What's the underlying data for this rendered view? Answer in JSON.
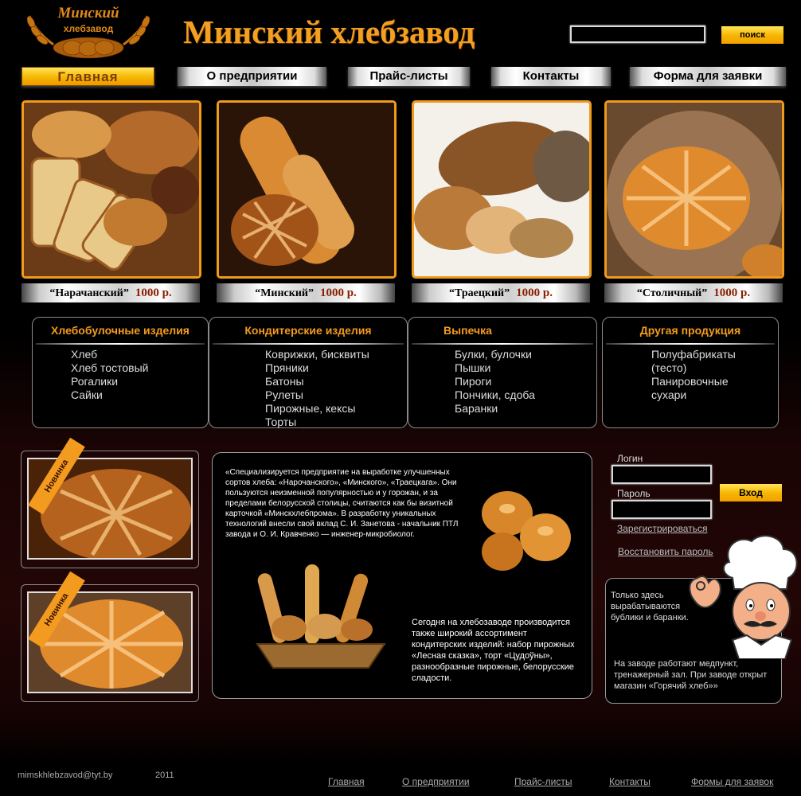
{
  "header": {
    "logo_line1": "Минский",
    "logo_line2": "хлебзавод",
    "title": "Минский хлебзавод",
    "search_placeholder": "",
    "search_button": "поиск"
  },
  "nav": {
    "items": [
      {
        "label": "Главная",
        "active": true
      },
      {
        "label": "О предприятии"
      },
      {
        "label": "Прайс-листы"
      },
      {
        "label": "Контакты"
      },
      {
        "label": "Форма для заявки"
      }
    ]
  },
  "products": [
    {
      "name": "“Нарачанский”",
      "price": "1000 р."
    },
    {
      "name": "“Минский”",
      "price": "1000 р."
    },
    {
      "name": "“Траецкий”",
      "price": "1000 р."
    },
    {
      "name": "“Столичный”",
      "price": "1000 р."
    }
  ],
  "categories": [
    {
      "title": "Хлебобулочные изделия",
      "items": [
        "Хлеб",
        "Хлеб тостовый",
        "Рогалики",
        "Сайки"
      ]
    },
    {
      "title": "Кондитерские изделия",
      "items": [
        "Коврижки, бисквиты",
        "Пряники",
        "Батоны",
        "Рулеты",
        "Пирожные, кексы",
        "Торты"
      ]
    },
    {
      "title": "Выпечка",
      "items": [
        "Булки, булочки",
        "Пышки",
        "Пироги",
        "Пончики, сдоба",
        "Баранки"
      ]
    },
    {
      "title": "Другая продукция",
      "items": [
        "Полуфабрикаты",
        "(тесто)",
        "Панировочные",
        "сухари"
      ]
    }
  ],
  "new_badge": "Новинка",
  "article": {
    "p1": "«Специализируется предприятие на выработке улучшенных сортов хлеба: «Нарочанского», «Минского», «Траецкага». Они пользуются неизменной популярностью и у горожан, и за пределами белорусской столицы, считаются как бы визитной карточкой «Минскхлебпрома». В разработку уникальных технологий внесли свой вклад С. И. Занетова - начальник ПТЛ завода и О. И. Кравченко — инженер-микробиолог.",
    "p2": "Сегодня на хлебозаводе производится также широкий ассортимент кондитерских изделий: набор пирожных «Лесная сказка», торт «Цудоўны», разнообразные пирожные, белорусские сладости."
  },
  "login": {
    "login_label": "Логин",
    "password_label": "Пароль",
    "login_value": "",
    "password_value": "",
    "submit": "Вход",
    "register": "Зарегистрироваться",
    "restore": "Восстановить пароль"
  },
  "info": {
    "p1": "Только здесь вырабатываются бублики и баранки.",
    "p2": "На заводе работают медпункт, тренажерный зал. При заводе открыт магазин «Горячий хлеб»»"
  },
  "footer": {
    "email": "mimskhlebzavod@tyt.by",
    "year": "2011",
    "links": [
      "Главная",
      "О предприятии",
      "Прайс-листы",
      "Контакты",
      "Формы для заявок"
    ]
  },
  "colors": {
    "accent": "#f39b1e",
    "frame": "#f09a1c",
    "button_yellow": "#f7b400"
  }
}
